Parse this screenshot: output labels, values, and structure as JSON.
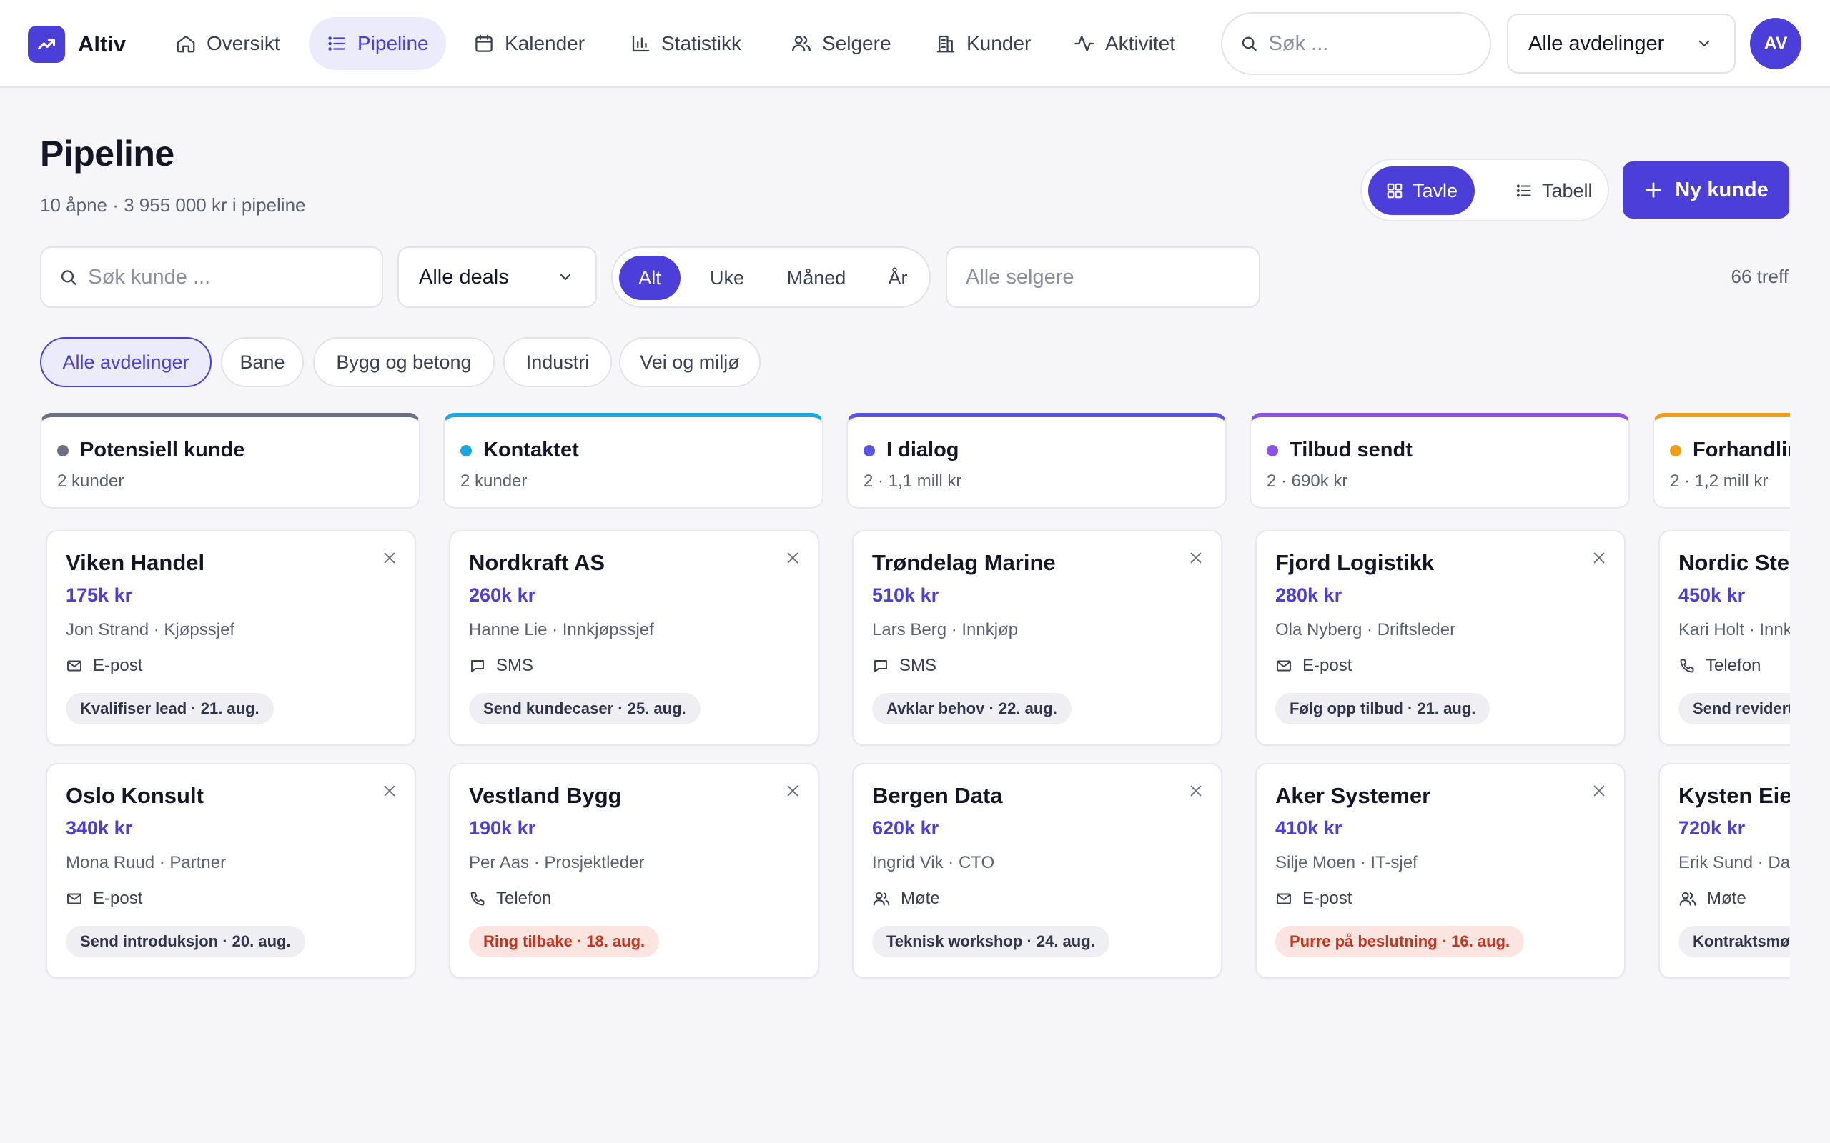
{
  "app": {
    "name": "Altiv"
  },
  "nav": {
    "items": [
      {
        "label": "Oversikt"
      },
      {
        "label": "Pipeline"
      },
      {
        "label": "Kalender"
      },
      {
        "label": "Statistikk"
      },
      {
        "label": "Selgere"
      },
      {
        "label": "Kunder"
      },
      {
        "label": "Aktivitet"
      }
    ],
    "active": "Pipeline",
    "search_placeholder": "Søk ...",
    "department": "Alle avdelinger",
    "avatar_initials": "AV"
  },
  "page": {
    "title": "Pipeline",
    "subtitle": "10 åpne · 3 955 000 kr i pipeline",
    "view_board": "Tavle",
    "view_table": "Tabell",
    "new_customer": "Ny kunde"
  },
  "filters": {
    "customer_search_placeholder": "Søk kunde ...",
    "deals": "Alle deals",
    "periods": [
      "Alt",
      "Uke",
      "Måned",
      "År"
    ],
    "active_period": "Alt",
    "seller_placeholder": "Alle selgere",
    "hits": "66 treff",
    "departments": [
      "Alle avdelinger",
      "Bane",
      "Bygg og betong",
      "Industri",
      "Vei og miljø"
    ],
    "active_department": "Alle avdelinger"
  },
  "colors": {
    "accent": "#4b3ed9",
    "stage_potensiell": "#6b7080",
    "stage_kontaktet": "#1aa6e0",
    "stage_dialog": "#5b55e6",
    "stage_tilbud": "#8b52e8",
    "stage_forhandling": "#f29d12",
    "warn_bg": "#fce4e1",
    "warn_text": "#c2351f"
  },
  "columns": [
    {
      "title": "Potensiell kunde",
      "summary": "2 kunder",
      "cards": [
        {
          "name": "Viken Handel",
          "amount": "175k kr",
          "contact": "Jon Strand · Kjøpssjef",
          "channel": "E-post",
          "channel_icon": "mail-icon",
          "task": "Kvalifiser lead · 21. aug."
        },
        {
          "name": "Oslo Konsult",
          "amount": "340k kr",
          "contact": "Mona Ruud · Partner",
          "channel": "E-post",
          "channel_icon": "mail-icon",
          "task": "Send introduksjon · 20. aug."
        }
      ]
    },
    {
      "title": "Kontaktet",
      "summary": "2 kunder",
      "cards": [
        {
          "name": "Nordkraft AS",
          "amount": "260k kr",
          "contact": "Hanne Lie · Innkjøpssjef",
          "channel": "SMS",
          "channel_icon": "message-icon",
          "task": "Send kundecaser · 25. aug."
        },
        {
          "name": "Vestland Bygg",
          "amount": "190k kr",
          "contact": "Per Aas · Prosjektleder",
          "channel": "Telefon",
          "channel_icon": "phone-icon",
          "task": "Ring tilbake · 18. aug.",
          "overdue": true
        }
      ]
    },
    {
      "title": "I dialog",
      "summary": "2 · 1,1 mill kr",
      "cards": [
        {
          "name": "Trøndelag Marine",
          "amount": "510k kr",
          "contact": "Lars Berg · Innkjøp",
          "channel": "SMS",
          "channel_icon": "message-icon",
          "task": "Avklar behov · 22. aug."
        },
        {
          "name": "Bergen Data",
          "amount": "620k kr",
          "contact": "Ingrid Vik · CTO",
          "channel": "Møte",
          "channel_icon": "people-icon",
          "task": "Teknisk workshop · 24. aug."
        }
      ]
    },
    {
      "title": "Tilbud sendt",
      "summary": "2 · 690k kr",
      "cards": [
        {
          "name": "Fjord Logistikk",
          "amount": "280k kr",
          "contact": "Ola Nyberg · Driftsleder",
          "channel": "E-post",
          "channel_icon": "mail-icon",
          "task": "Følg opp tilbud · 21. aug."
        },
        {
          "name": "Aker Systemer",
          "amount": "410k kr",
          "contact": "Silje Moen · IT-sjef",
          "channel": "E-post",
          "channel_icon": "mail-icon",
          "task": "Purre på beslutning · 16. aug.",
          "overdue": true
        }
      ]
    },
    {
      "title": "Forhandling",
      "summary": "2 · 1,2 mill kr",
      "cards": [
        {
          "name": "Nordic Steel",
          "amount": "450k kr",
          "contact": "Kari Holt · Innkjøp",
          "channel": "Telefon",
          "channel_icon": "phone-icon",
          "task": "Send revidert tilbud"
        },
        {
          "name": "Kysten Eiendom",
          "amount": "720k kr",
          "contact": "Erik Sund · Daglig leder",
          "channel": "Møte",
          "channel_icon": "people-icon",
          "task": "Kontraktsmøte"
        }
      ]
    }
  ]
}
